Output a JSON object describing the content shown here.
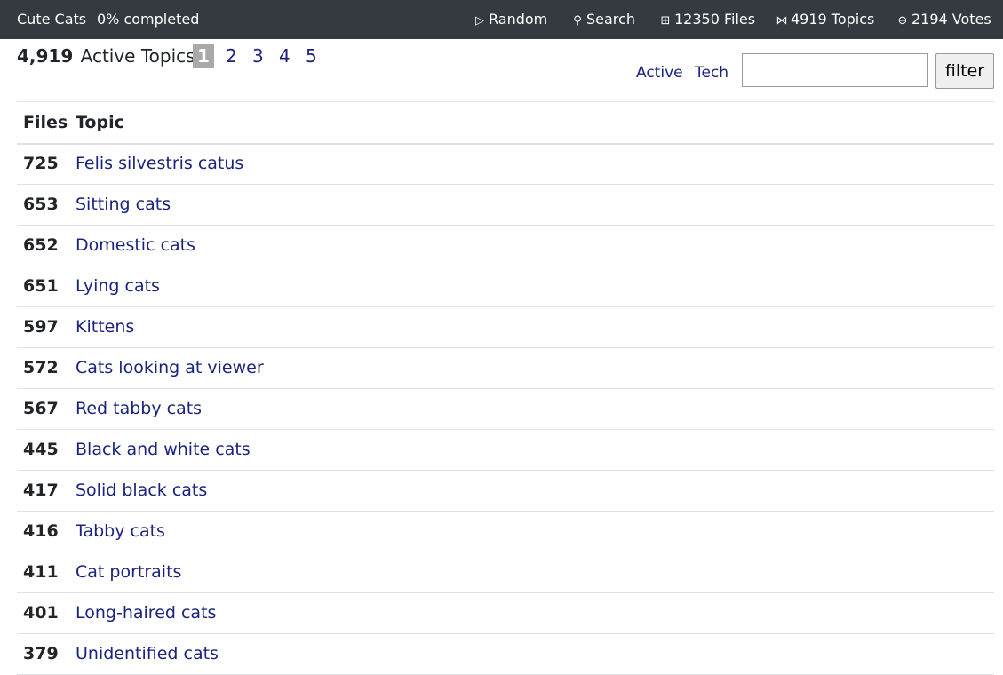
{
  "header": {
    "brand": "Cute Cats",
    "progress": "0% completed",
    "nav": [
      {
        "icon": "play-icon",
        "glyph": "▷",
        "label": "Random"
      },
      {
        "icon": "search-icon",
        "glyph": "⚲",
        "label": "Search"
      },
      {
        "icon": "grid-icon",
        "glyph": "⊞",
        "label": "12350 Files"
      },
      {
        "icon": "bowtie-icon",
        "glyph": "⋈",
        "label": "4919 Topics"
      },
      {
        "icon": "circle-minus-icon",
        "glyph": "⊖",
        "label": "2194 Votes"
      }
    ]
  },
  "summary": {
    "count": "4,919",
    "label": "Active Topics:"
  },
  "pagination": {
    "current": "1",
    "pages": [
      "1",
      "2",
      "3",
      "4",
      "5"
    ]
  },
  "filters": {
    "links": [
      "Active",
      "Tech"
    ],
    "input_value": "",
    "button_label": "filter"
  },
  "table": {
    "columns": [
      "Files",
      "Topic"
    ],
    "rows": [
      {
        "files": "725",
        "topic": "Felis silvestris catus"
      },
      {
        "files": "653",
        "topic": "Sitting cats"
      },
      {
        "files": "652",
        "topic": "Domestic cats"
      },
      {
        "files": "651",
        "topic": "Lying cats"
      },
      {
        "files": "597",
        "topic": "Kittens"
      },
      {
        "files": "572",
        "topic": "Cats looking at viewer"
      },
      {
        "files": "567",
        "topic": "Red tabby cats"
      },
      {
        "files": "445",
        "topic": "Black and white cats"
      },
      {
        "files": "417",
        "topic": "Solid black cats"
      },
      {
        "files": "416",
        "topic": "Tabby cats"
      },
      {
        "files": "411",
        "topic": "Cat portraits"
      },
      {
        "files": "401",
        "topic": "Long-haired cats"
      },
      {
        "files": "379",
        "topic": "Unidentified cats"
      }
    ]
  },
  "colors": {
    "topbar": "#343a40",
    "link": "#1a237e",
    "current_page_bg": "#a9a9a9"
  }
}
